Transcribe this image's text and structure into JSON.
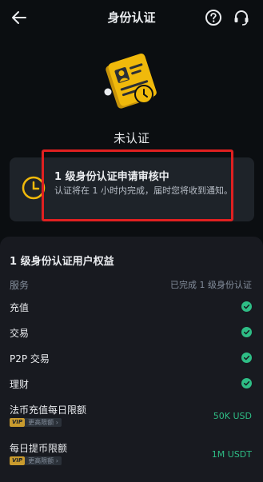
{
  "header": {
    "title": "身份认证",
    "back_icon": "arrow-left-icon",
    "help_icon": "question-circle-icon",
    "support_icon": "headset-icon"
  },
  "status": {
    "label": "未认证"
  },
  "pending": {
    "title": "1 级身份认证申请审核中",
    "description": "认证将在 1 小时内完成，届时您将收到通知。",
    "icon": "clock-icon"
  },
  "benefits": {
    "title": "1 级身份认证用户权益",
    "header_label": "服务",
    "header_status": "已完成 1 级身份认证",
    "rows": [
      {
        "label": "充值"
      },
      {
        "label": "交易"
      },
      {
        "label": "P2P 交易"
      },
      {
        "label": "理财"
      }
    ],
    "limits": [
      {
        "label": "法币充值每日限额",
        "vip": "VIP",
        "vip_link": "更高限额 ›",
        "value": "50K USD"
      },
      {
        "label": "每日提币限额",
        "vip": "VIP",
        "vip_link": "更高限额 ›",
        "value": "1M USDT"
      }
    ]
  },
  "colors": {
    "background": "#0b0e11",
    "card": "#1e2329",
    "accent_yellow": "#f0b90b",
    "success_green": "#2ebd85",
    "highlight_red": "#e02020"
  }
}
